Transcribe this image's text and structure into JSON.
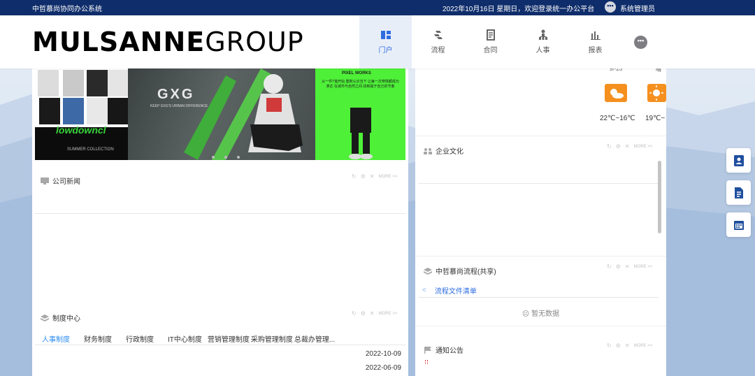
{
  "topbar": {
    "system_name": "中哲慕尚协同办公系统",
    "date_welcome": "2022年10月16日 星期日，欢迎登录统一办公平台",
    "user_name": "系统管理员",
    "user_icon": "more-dots-icon"
  },
  "header": {
    "logo_bold": "MULSANNE",
    "logo_light": "GROUP",
    "nav": [
      {
        "label": "门户",
        "icon": "portal-icon",
        "active": true
      },
      {
        "label": "流程",
        "icon": "workflow-icon",
        "active": false
      },
      {
        "label": "合同",
        "icon": "contract-icon",
        "active": false
      },
      {
        "label": "人事",
        "icon": "hr-icon",
        "active": false
      },
      {
        "label": "报表",
        "icon": "report-icon",
        "active": false
      }
    ],
    "more_icon": "more-dots-icon"
  },
  "banner": {
    "brand": "GXG",
    "slogan": "KEEP GXG'S URBAN DIFFERENCE",
    "left_script": "lowdowncl",
    "left_sub": "SUMMER COLLECTION",
    "right_header": "PIXEL WORKS",
    "right_text": "从一件T恤开始 重新认识当下 让每一次穿搭都成为表达 在城市与自然之间 找到属于自己的节奏"
  },
  "left_panels": {
    "news": {
      "title": "公司新闻",
      "more": "MORE >>"
    },
    "policy": {
      "title": "制度中心",
      "more": "MORE >>",
      "tabs": [
        "人事制度",
        "财务制度",
        "行政制度",
        "IT中心制度",
        "营销管理制度",
        "采购管理制度",
        "总裁办管理..."
      ],
      "dates": [
        "2022-10-09",
        "2022-06-09"
      ]
    }
  },
  "right_panels": {
    "weather": [
      {
        "icon": "sun-cloud-icon",
        "temp": "22℃~16℃",
        "top_label": "9/-23"
      },
      {
        "icon": "sun-icon",
        "temp": "19℃~",
        "top_label": "晴"
      }
    ],
    "culture": {
      "title": "企业文化",
      "more": "MORE >>"
    },
    "flow": {
      "title": "中哲慕尚流程(共享)",
      "more": "MORE >>",
      "link": "流程文件清单",
      "empty": "暂无数据"
    },
    "notice": {
      "title": "通知公告",
      "more": "MORE >>"
    }
  },
  "side_buttons": [
    "contacts-icon",
    "document-icon",
    "calendar-icon"
  ],
  "colors": {
    "topbar": "#0f2d6b",
    "accent": "#2d6ce0",
    "tab_active": "#2d8cf0",
    "weather": "#f5901f"
  }
}
